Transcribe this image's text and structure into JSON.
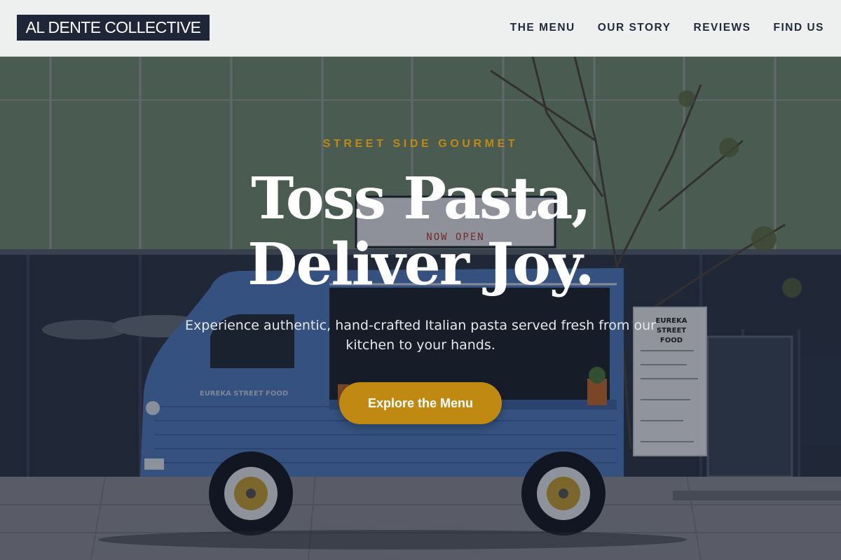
{
  "brand": {
    "logo_text": "AL DENTE COLLECTIVE"
  },
  "nav": {
    "items": [
      {
        "label": "THE MENU"
      },
      {
        "label": "OUR STORY"
      },
      {
        "label": "REVIEWS"
      },
      {
        "label": "FIND US"
      }
    ]
  },
  "hero": {
    "kicker": "STREET SIDE GOURMET",
    "title_line1": "Toss Pasta,",
    "title_line2": "Deliver Joy.",
    "subtitle": "Experience authentic, hand-crafted Italian pasta served fresh from our kitchen to your hands.",
    "cta_label": "Explore the Menu"
  },
  "background_photo": {
    "truck_signboard": "NOW OPEN",
    "menu_board_title": "EUREKA STREET FOOD",
    "truck_side_text": "EUREKA STREET FOOD"
  },
  "colors": {
    "accent": "#c08a12",
    "header_bg": "#eeefef",
    "logo_bg": "#1e2638",
    "truck_blue": "#4f7cc0"
  }
}
